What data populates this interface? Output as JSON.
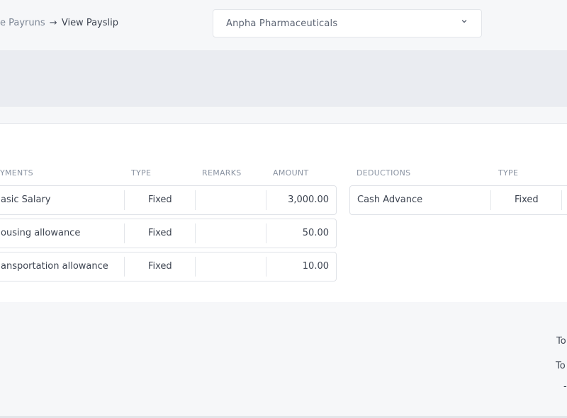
{
  "breadcrumb": {
    "previous": "e Payruns",
    "arrow": "→",
    "current": "View Payslip"
  },
  "company_select": {
    "selected": "Anpha Pharmaceuticals"
  },
  "payments_table": {
    "headers": [
      "YMENTS",
      "TYPE",
      "REMARKS",
      "AMOUNT"
    ],
    "rows": [
      {
        "name": "asic Salary",
        "type": "Fixed",
        "remarks": "",
        "amount": "3,000.00"
      },
      {
        "name": "ousing allowance",
        "type": "Fixed",
        "remarks": "",
        "amount": "50.00"
      },
      {
        "name": "ansportation allowance",
        "type": "Fixed",
        "remarks": "",
        "amount": "10.00"
      }
    ]
  },
  "deductions_table": {
    "headers": [
      "DEDUCTIONS",
      "TYPE"
    ],
    "rows": [
      {
        "name": "Cash Advance",
        "type": "Fixed"
      }
    ]
  },
  "totals": {
    "line1": "To",
    "line2": "To",
    "line3": "-"
  },
  "colors": {
    "page_bg": "#f6f7f9",
    "banner_bg": "#eaecf1",
    "card_bg": "#ffffff",
    "border": "#dfe2e7",
    "text": "#3d4451",
    "muted": "#8a93a2"
  },
  "icons": {
    "select_chevron": "chevron-down-icon"
  }
}
